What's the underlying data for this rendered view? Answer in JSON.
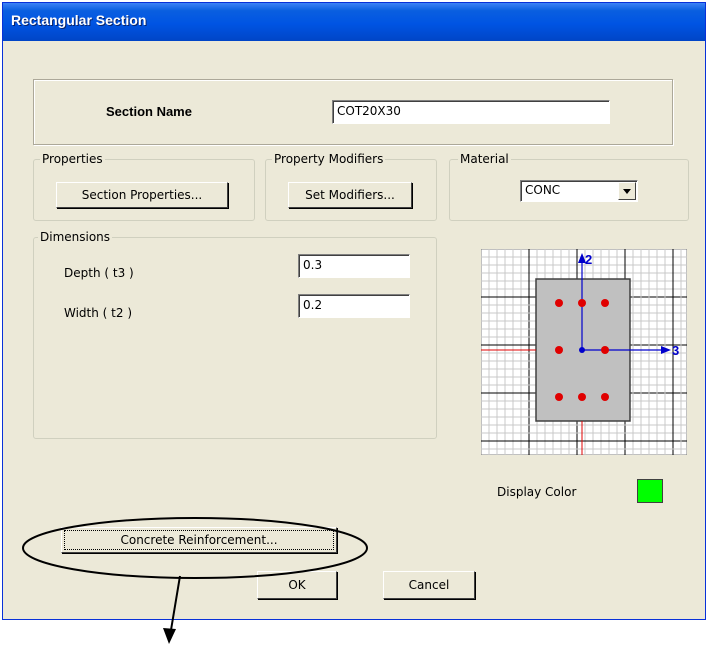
{
  "window": {
    "title": "Rectangular Section"
  },
  "section_name": {
    "label": "Section Name",
    "value": "COT20X30"
  },
  "properties": {
    "group_label": "Properties",
    "button_label": "Section Properties..."
  },
  "modifiers": {
    "group_label": "Property Modifiers",
    "button_label": "Set Modifiers..."
  },
  "material": {
    "group_label": "Material",
    "selected": "CONC"
  },
  "dimensions": {
    "group_label": "Dimensions",
    "depth": {
      "label": "Depth  ( t3 )",
      "value": "0.3"
    },
    "width": {
      "label": "Width  ( t2 )",
      "value": "0.2"
    }
  },
  "preview": {
    "axis_2_label": "2",
    "axis_3_label": "3"
  },
  "display_color": {
    "label": "Display Color",
    "color": "#00ff00"
  },
  "concrete_reinforcement": {
    "button_label": "Concrete Reinforcement..."
  },
  "footer": {
    "ok_label": "OK",
    "cancel_label": "Cancel"
  },
  "colors": {
    "title_bar": "#0054e3",
    "rebar": "#e00000",
    "axis": "#0000cc",
    "section_fill": "#c0c0c0"
  }
}
